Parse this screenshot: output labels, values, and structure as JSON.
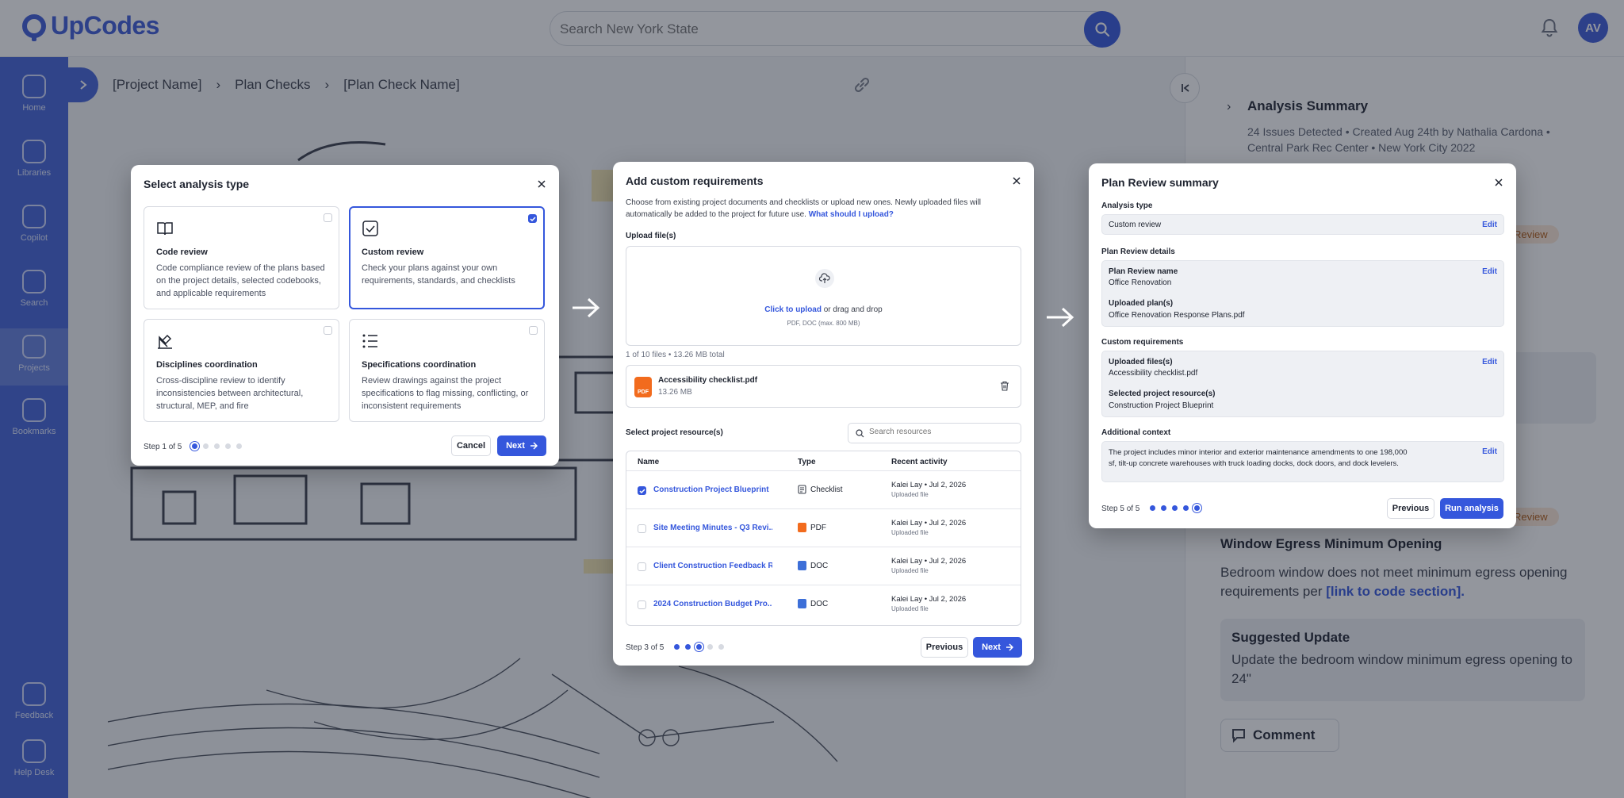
{
  "app": {
    "brand": "UpCodes",
    "search_placeholder": "Search New York State",
    "avatar_initials": "AV",
    "sidebar": [
      {
        "label": "Home"
      },
      {
        "label": "Libraries"
      },
      {
        "label": "Copilot"
      },
      {
        "label": "Search"
      },
      {
        "label": "Projects"
      },
      {
        "label": "Bookmarks"
      },
      {
        "label": "Feedback"
      },
      {
        "label": "Help Desk"
      }
    ],
    "breadcrumb": [
      "[Project Name]",
      "Plan Checks",
      "[Plan Check Name]"
    ],
    "panel": {
      "title": "Analysis Summary",
      "meta": "24 Issues Detected • Created Aug 24th by Nathalia Cardona • Central Park Rec Center • New York City 2022",
      "badge": "Review",
      "issue_title": "Window Egress Minimum Opening",
      "issue_desc": "Bedroom window does not meet minimum egress opening requirements per",
      "issue_link": "[link to code section].",
      "suggest_title": "Suggested Update",
      "suggest_body": "Update the bedroom window minimum egress opening to 24\"",
      "comment": "Comment"
    }
  },
  "modal1": {
    "title": "Select analysis type",
    "options": [
      {
        "title": "Code review",
        "desc": "Code compliance review of the plans based on the project details, selected codebooks, and applicable requirements",
        "selected": false
      },
      {
        "title": "Custom review",
        "desc": "Check your plans against your own requirements, standards, and checklists",
        "selected": true
      },
      {
        "title": "Disciplines coordination",
        "desc": "Cross-discipline review to identify inconsistencies between architectural, structural, MEP, and fire",
        "selected": false
      },
      {
        "title": "Specifications coordination",
        "desc": "Review drawings against the project specifications to flag missing, conflicting, or inconsistent requirements",
        "selected": false
      }
    ],
    "step": "Step 1 of 5",
    "step_index": 1,
    "cancel": "Cancel",
    "next": "Next"
  },
  "modal2": {
    "title": "Add custom requirements",
    "desc": "Choose from existing project documents and checklists or upload new ones. Newly uploaded files will automatically be added to the project for future use.",
    "desc_link": "What should I upload?",
    "upload_label": "Upload file(s)",
    "upload_link": "Click to upload",
    "upload_text": "or drag and drop",
    "upload_hint": "PDF, DOC (max. 800 MB)",
    "file_count": "1 of 10 files • 13.26 MB total",
    "file": {
      "name": "Accessibility checklist.pdf",
      "size": "13.26 MB",
      "badge": "PDF"
    },
    "resources_label": "Select project resource(s)",
    "resources_search_placeholder": "Search resources",
    "columns": [
      "Name",
      "Type",
      "Recent activity"
    ],
    "rows": [
      {
        "name": "Construction Project Blueprint",
        "type": "Checklist",
        "activity": "Kalei Lay • Jul 2, 2026",
        "sub": "Uploaded file",
        "checked": true,
        "icon": "checklist-icon"
      },
      {
        "name": "Site Meeting Minutes - Q3 Revi...",
        "type": "PDF",
        "activity": "Kalei Lay • Jul 2, 2026",
        "sub": "Uploaded file",
        "checked": false,
        "icon": "pdf-file-icon"
      },
      {
        "name": "Client Construction Feedback R...",
        "type": "DOC",
        "activity": "Kalei Lay • Jul 2, 2026",
        "sub": "Uploaded file",
        "checked": false,
        "icon": "doc-file-icon"
      },
      {
        "name": "2024 Construction Budget Pro...",
        "type": "DOC",
        "activity": "Kalei Lay • Jul 2, 2026",
        "sub": "Uploaded file",
        "checked": false,
        "icon": "doc-file-icon"
      }
    ],
    "step": "Step 3 of 5",
    "step_index": 3,
    "previous": "Previous",
    "next": "Next"
  },
  "modal3": {
    "title": "Plan Review summary",
    "analysis_type_label": "Analysis type",
    "analysis_type_value": "Custom review",
    "details_label": "Plan Review details",
    "name_key": "Plan Review name",
    "name_value": "Office Renovation",
    "plans_key": "Uploaded plan(s)",
    "plans_value": "Office Renovation Response Plans.pdf",
    "custom_label": "Custom requirements",
    "files_key": "Uploaded files(s)",
    "files_value": "Accessibility checklist.pdf",
    "resources_key": "Selected project resource(s)",
    "resources_value": "Construction Project Blueprint",
    "context_label": "Additional context",
    "context_value": "The project includes minor interior and exterior maintenance amendments to one 198,000 sf, tilt-up concrete warehouses with truck loading docks, dock doors, and dock levelers.",
    "edit": "Edit",
    "step": "Step 5 of 5",
    "step_index": 5,
    "previous": "Previous",
    "run": "Run analysis"
  },
  "colors": {
    "accent": "#3557dc",
    "sidebar": "#4163d8",
    "overlay": "rgba(30,36,50,0.48)"
  }
}
